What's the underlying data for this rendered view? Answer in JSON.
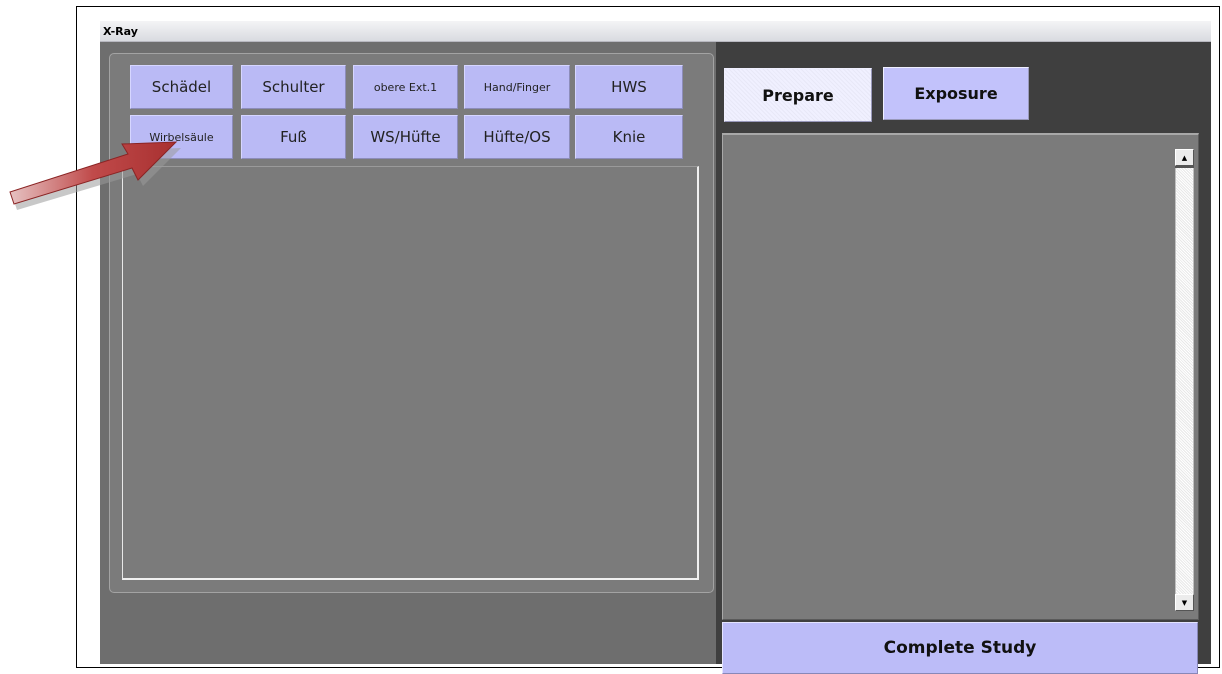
{
  "window": {
    "title": "X-Ray"
  },
  "categories": {
    "row1": [
      "Schädel",
      "Schulter",
      "obere Ext.1",
      "Hand/Finger",
      "HWS"
    ],
    "row2": [
      "Wirbelsäule",
      "Fuß",
      "WS/Hüfte",
      "Hüfte/OS",
      "Knie"
    ]
  },
  "tabs": {
    "prepare": "Prepare",
    "exposure": "Exposure"
  },
  "actions": {
    "complete_study": "Complete Study"
  },
  "colors": {
    "button": "#babaf5",
    "panel": "#7b7b7b",
    "annotation_arrow": "#b03a3a"
  }
}
